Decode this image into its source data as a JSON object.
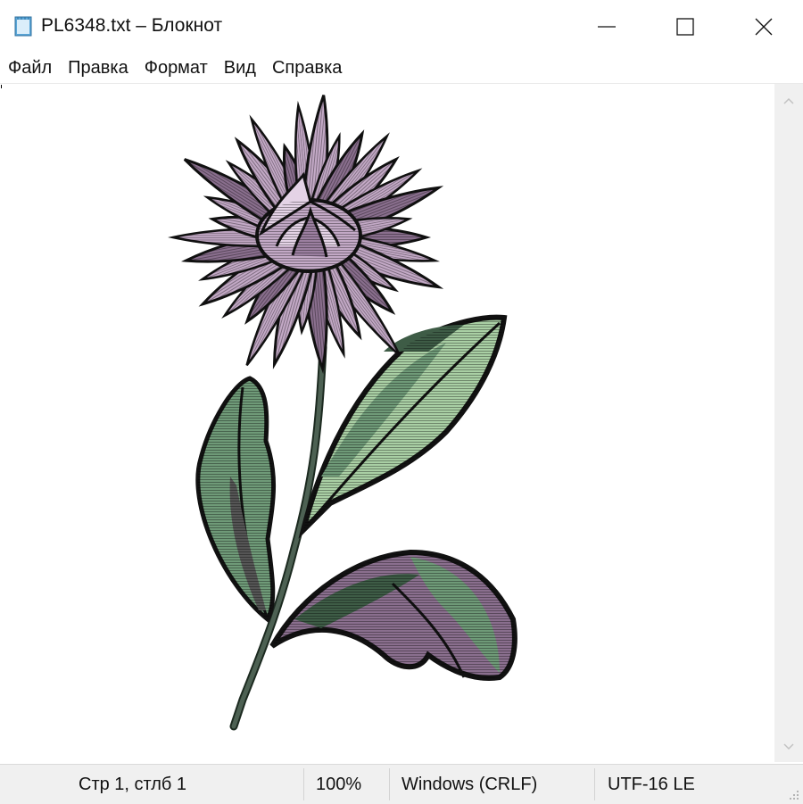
{
  "window": {
    "title": "PL6348.txt – Блокнот",
    "icon": "notepad-icon"
  },
  "menu": {
    "items": [
      "Файл",
      "Правка",
      "Формат",
      "Вид",
      "Справка"
    ]
  },
  "statusbar": {
    "position": "Стр 1, стлб 1",
    "zoom": "100%",
    "line_endings": "Windows (CRLF)",
    "encoding": "UTF-16 LE"
  },
  "colors": {
    "petal": "#c3a9c6",
    "petal_dark": "#8a6f8e",
    "leaf": "#6f9a78",
    "leaf_light": "#a9cfa4",
    "leaf_dark": "#3e5c46",
    "stem": "#4d6153"
  },
  "content": {
    "picture": "ascii-art-aster-flower"
  }
}
